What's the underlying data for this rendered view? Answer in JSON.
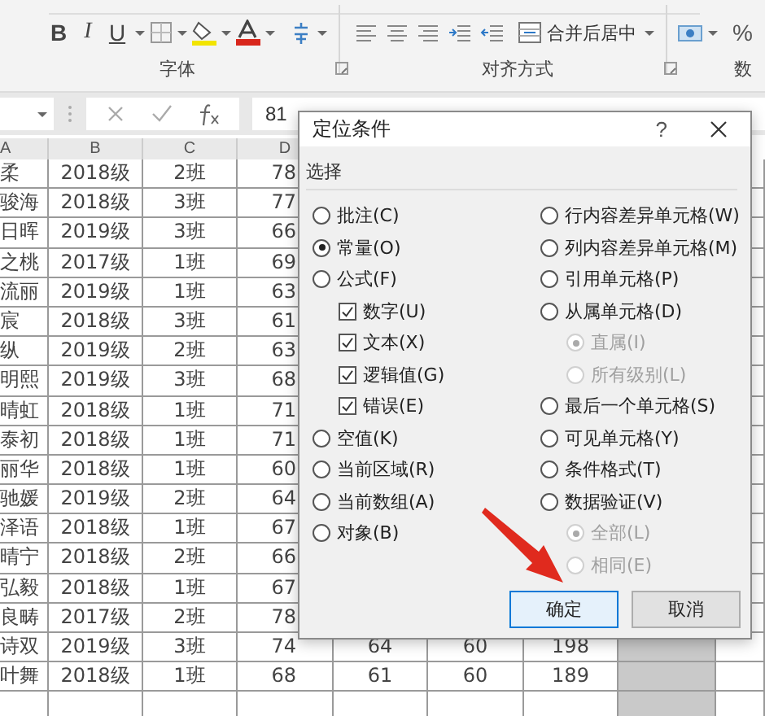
{
  "ribbon": {
    "font_buttons": [
      "B",
      "I",
      "U"
    ],
    "merge_button": "合并后居中",
    "percent_button": "%",
    "groups": [
      {
        "label": "字体"
      },
      {
        "label": "对齐方式"
      },
      {
        "label": "数"
      }
    ]
  },
  "formula_bar": {
    "value": "81"
  },
  "sheet": {
    "columns": [
      {
        "label": "A",
        "selected": false
      },
      {
        "label": "B",
        "selected": false
      },
      {
        "label": "C",
        "selected": false
      },
      {
        "label": "D",
        "selected": false
      },
      {
        "selected": false
      },
      {
        "selected": false
      },
      {
        "selected": false
      },
      {
        "selected": true
      },
      {
        "selected": false
      }
    ],
    "rows": [
      {
        "cells": [
          "柔",
          "2018级",
          "2班",
          "78"
        ]
      },
      {
        "cells": [
          "骏海",
          "2018级",
          "3班",
          "77"
        ]
      },
      {
        "cells": [
          "日晖",
          "2019级",
          "3班",
          "66"
        ]
      },
      {
        "cells": [
          "之桃",
          "2017级",
          "1班",
          "69"
        ]
      },
      {
        "cells": [
          "流丽",
          "2019级",
          "1班",
          "63"
        ]
      },
      {
        "cells": [
          "宸",
          "2018级",
          "3班",
          "61"
        ]
      },
      {
        "cells": [
          "纵",
          "2019级",
          "2班",
          "63"
        ]
      },
      {
        "cells": [
          "明熙",
          "2019级",
          "3班",
          "68"
        ]
      },
      {
        "cells": [
          "晴虹",
          "2018级",
          "1班",
          "71"
        ]
      },
      {
        "cells": [
          "泰初",
          "2018级",
          "1班",
          "71"
        ]
      },
      {
        "cells": [
          "丽华",
          "2018级",
          "1班",
          "60"
        ]
      },
      {
        "cells": [
          "驰媛",
          "2019级",
          "2班",
          "64"
        ]
      },
      {
        "cells": [
          "泽语",
          "2018级",
          "1班",
          "67"
        ]
      },
      {
        "cells": [
          "晴宁",
          "2018级",
          "2班",
          "66"
        ]
      },
      {
        "cells": [
          "弘毅",
          "2018级",
          "1班",
          "67"
        ]
      },
      {
        "cells": [
          "良畴",
          "2017级",
          "2班",
          "78"
        ]
      },
      {
        "cells": [
          "诗双",
          "2019级",
          "3班",
          "74",
          "64",
          "60",
          "198"
        ]
      },
      {
        "cells": [
          "叶舞",
          "2018级",
          "1班",
          "68",
          "61",
          "60",
          "189"
        ]
      }
    ]
  },
  "dialog": {
    "title": "定位条件",
    "help": "?",
    "group_label": "选择",
    "left": [
      {
        "kind": "radio",
        "label": "批注(C)",
        "selected": false
      },
      {
        "kind": "radio",
        "label": "常量(O)",
        "selected": true
      },
      {
        "kind": "radio",
        "label": "公式(F)",
        "selected": false,
        "children": [
          {
            "kind": "checkbox",
            "label": "数字(U)",
            "checked": true
          },
          {
            "kind": "checkbox",
            "label": "文本(X)",
            "checked": true
          },
          {
            "kind": "checkbox",
            "label": "逻辑值(G)",
            "checked": true
          },
          {
            "kind": "checkbox",
            "label": "错误(E)",
            "checked": true
          }
        ]
      },
      {
        "kind": "radio",
        "label": "空值(K)",
        "selected": false
      },
      {
        "kind": "radio",
        "label": "当前区域(R)",
        "selected": false
      },
      {
        "kind": "radio",
        "label": "当前数组(A)",
        "selected": false
      },
      {
        "kind": "radio",
        "label": "对象(B)",
        "selected": false
      }
    ],
    "right": [
      {
        "kind": "radio",
        "label": "行内容差异单元格(W)",
        "selected": false
      },
      {
        "kind": "radio",
        "label": "列内容差异单元格(M)",
        "selected": false
      },
      {
        "kind": "radio",
        "label": "引用单元格(P)",
        "selected": false
      },
      {
        "kind": "radio",
        "label": "从属单元格(D)",
        "selected": false,
        "children": [
          {
            "kind": "radio",
            "label": "直属(I)",
            "selected": true,
            "disabled": true
          },
          {
            "kind": "radio",
            "label": "所有级别(L)",
            "selected": false,
            "disabled": true
          }
        ]
      },
      {
        "kind": "radio",
        "label": "最后一个单元格(S)",
        "selected": false
      },
      {
        "kind": "radio",
        "label": "可见单元格(Y)",
        "selected": false
      },
      {
        "kind": "radio",
        "label": "条件格式(T)",
        "selected": false
      },
      {
        "kind": "radio",
        "label": "数据验证(V)",
        "selected": false,
        "children": [
          {
            "kind": "radio",
            "label": "全部(L)",
            "selected": true,
            "disabled": true
          },
          {
            "kind": "radio",
            "label": "相同(E)",
            "selected": false,
            "disabled": true
          }
        ]
      }
    ],
    "buttons": [
      {
        "label": "确定",
        "default": true
      },
      {
        "label": "取消",
        "default": false
      }
    ]
  }
}
